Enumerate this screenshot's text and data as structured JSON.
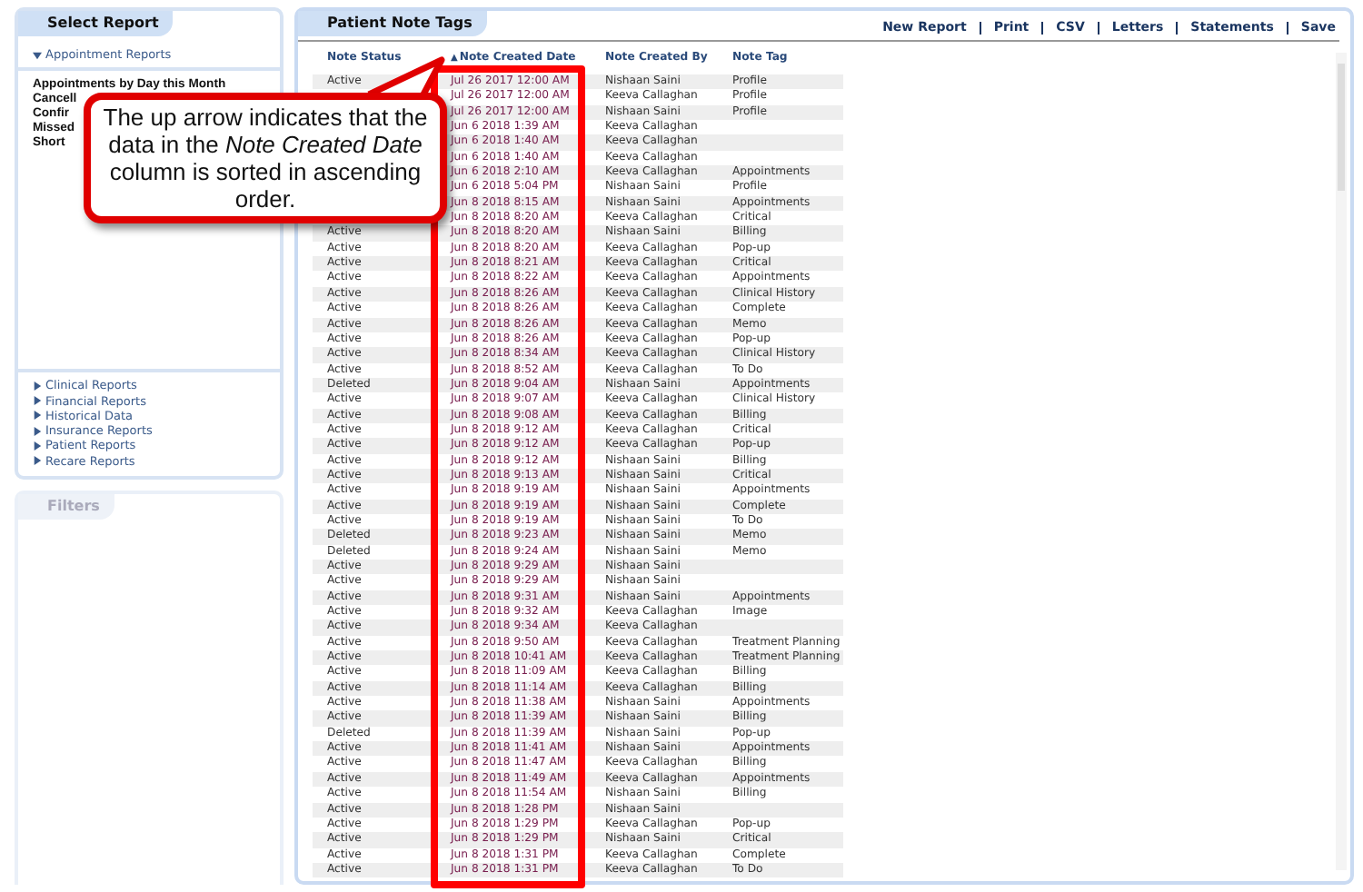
{
  "sidebar": {
    "title": "Select Report",
    "group": {
      "label": "Appointment Reports",
      "expanded": true
    },
    "items": [
      "Appointments by Day this Month",
      "Cancell",
      "Confir",
      "Missed",
      "Short"
    ],
    "categories": [
      {
        "label": "Clinical Reports",
        "expanded": false
      },
      {
        "label": "Financial Reports",
        "expanded": false
      },
      {
        "label": "Historical Data",
        "expanded": false
      },
      {
        "label": "Insurance Reports",
        "expanded": false
      },
      {
        "label": "Patient Reports",
        "expanded": false
      },
      {
        "label": "Recare Reports",
        "expanded": false
      }
    ],
    "filters_title": "Filters"
  },
  "report": {
    "title": "Patient Note Tags",
    "actions": [
      "New Report",
      "Print",
      "CSV",
      "Letters",
      "Statements",
      "Save"
    ],
    "columns": [
      {
        "label": "Note Status"
      },
      {
        "label": "Note Created Date",
        "sort_arrow": "▲"
      },
      {
        "label": "Note Created By"
      },
      {
        "label": "Note Tag"
      }
    ],
    "rows": [
      {
        "status": "Active",
        "date": "Jul 26 2017 12:00 AM",
        "by": "Nishaan Saini",
        "tag": "Profile"
      },
      {
        "date": "Jul 26 2017 12:00 AM",
        "by": "Keeva Callaghan",
        "tag": "Profile"
      },
      {
        "date": "Jul 26 2017 12:00 AM",
        "by": "Nishaan Saini",
        "tag": "Profile"
      },
      {
        "date": "Jun 6 2018 1:39 AM",
        "by": "Keeva Callaghan"
      },
      {
        "date": "Jun 6 2018 1:40 AM",
        "by": "Keeva Callaghan"
      },
      {
        "date": "Jun 6 2018 1:40 AM",
        "by": "Keeva Callaghan"
      },
      {
        "date": "Jun 6 2018 2:10 AM",
        "by": "Keeva Callaghan",
        "tag": "Appointments"
      },
      {
        "date": "Jun 6 2018 5:04 PM",
        "by": "Nishaan Saini",
        "tag": "Profile"
      },
      {
        "date": "Jun 8 2018 8:15 AM",
        "by": "Nishaan Saini",
        "tag": "Appointments"
      },
      {
        "date": "Jun 8 2018 8:20 AM",
        "by": "Keeva Callaghan",
        "tag": "Critical"
      },
      {
        "status": "Active",
        "date": "Jun 8 2018 8:20 AM",
        "by": "Nishaan Saini",
        "tag": "Billing"
      },
      {
        "status": "Active",
        "date": "Jun 8 2018 8:20 AM",
        "by": "Keeva Callaghan",
        "tag": "Pop-up"
      },
      {
        "status": "Active",
        "date": "Jun 8 2018 8:21 AM",
        "by": "Keeva Callaghan",
        "tag": "Critical"
      },
      {
        "status": "Active",
        "date": "Jun 8 2018 8:22 AM",
        "by": "Keeva Callaghan",
        "tag": "Appointments"
      },
      {
        "status": "Active",
        "date": "Jun 8 2018 8:26 AM",
        "by": "Keeva Callaghan",
        "tag": "Clinical History"
      },
      {
        "status": "Active",
        "date": "Jun 8 2018 8:26 AM",
        "by": "Keeva Callaghan",
        "tag": "Complete"
      },
      {
        "status": "Active",
        "date": "Jun 8 2018 8:26 AM",
        "by": "Keeva Callaghan",
        "tag": "Memo"
      },
      {
        "status": "Active",
        "date": "Jun 8 2018 8:26 AM",
        "by": "Keeva Callaghan",
        "tag": "Pop-up"
      },
      {
        "status": "Active",
        "date": "Jun 8 2018 8:34 AM",
        "by": "Keeva Callaghan",
        "tag": "Clinical History"
      },
      {
        "status": "Active",
        "date": "Jun 8 2018 8:52 AM",
        "by": "Keeva Callaghan",
        "tag": "To Do"
      },
      {
        "status": "Deleted",
        "date": "Jun 8 2018 9:04 AM",
        "by": "Nishaan Saini",
        "tag": "Appointments"
      },
      {
        "status": "Active",
        "date": "Jun 8 2018 9:07 AM",
        "by": "Keeva Callaghan",
        "tag": "Clinical History"
      },
      {
        "status": "Active",
        "date": "Jun 8 2018 9:08 AM",
        "by": "Keeva Callaghan",
        "tag": "Billing"
      },
      {
        "status": "Active",
        "date": "Jun 8 2018 9:12 AM",
        "by": "Keeva Callaghan",
        "tag": "Critical"
      },
      {
        "status": "Active",
        "date": "Jun 8 2018 9:12 AM",
        "by": "Keeva Callaghan",
        "tag": "Pop-up"
      },
      {
        "status": "Active",
        "date": "Jun 8 2018 9:12 AM",
        "by": "Nishaan Saini",
        "tag": "Billing"
      },
      {
        "status": "Active",
        "date": "Jun 8 2018 9:13 AM",
        "by": "Nishaan Saini",
        "tag": "Critical"
      },
      {
        "status": "Active",
        "date": "Jun 8 2018 9:19 AM",
        "by": "Nishaan Saini",
        "tag": "Appointments"
      },
      {
        "status": "Active",
        "date": "Jun 8 2018 9:19 AM",
        "by": "Nishaan Saini",
        "tag": "Complete"
      },
      {
        "status": "Active",
        "date": "Jun 8 2018 9:19 AM",
        "by": "Nishaan Saini",
        "tag": "To Do"
      },
      {
        "status": "Deleted",
        "date": "Jun 8 2018 9:23 AM",
        "by": "Nishaan Saini",
        "tag": "Memo"
      },
      {
        "status": "Deleted",
        "date": "Jun 8 2018 9:24 AM",
        "by": "Nishaan Saini",
        "tag": "Memo"
      },
      {
        "status": "Active",
        "date": "Jun 8 2018 9:29 AM",
        "by": "Nishaan Saini"
      },
      {
        "status": "Active",
        "date": "Jun 8 2018 9:29 AM",
        "by": "Nishaan Saini"
      },
      {
        "status": "Active",
        "date": "Jun 8 2018 9:31 AM",
        "by": "Nishaan Saini",
        "tag": "Appointments"
      },
      {
        "status": "Active",
        "date": "Jun 8 2018 9:32 AM",
        "by": "Keeva Callaghan",
        "tag": "Image"
      },
      {
        "status": "Active",
        "date": "Jun 8 2018 9:34 AM",
        "by": "Keeva Callaghan"
      },
      {
        "status": "Active",
        "date": "Jun 8 2018 9:50 AM",
        "by": "Keeva Callaghan",
        "tag": "Treatment Planning"
      },
      {
        "status": "Active",
        "date": "Jun 8 2018 10:41 AM",
        "by": "Keeva Callaghan",
        "tag": "Treatment Planning"
      },
      {
        "status": "Active",
        "date": "Jun 8 2018 11:09 AM",
        "by": "Keeva Callaghan",
        "tag": "Billing"
      },
      {
        "status": "Active",
        "date": "Jun 8 2018 11:14 AM",
        "by": "Keeva Callaghan",
        "tag": "Billing"
      },
      {
        "status": "Active",
        "date": "Jun 8 2018 11:38 AM",
        "by": "Nishaan Saini",
        "tag": "Appointments"
      },
      {
        "status": "Active",
        "date": "Jun 8 2018 11:39 AM",
        "by": "Nishaan Saini",
        "tag": "Billing"
      },
      {
        "status": "Deleted",
        "date": "Jun 8 2018 11:39 AM",
        "by": "Nishaan Saini",
        "tag": "Pop-up"
      },
      {
        "status": "Active",
        "date": "Jun 8 2018 11:41 AM",
        "by": "Nishaan Saini",
        "tag": "Appointments"
      },
      {
        "status": "Active",
        "date": "Jun 8 2018 11:47 AM",
        "by": "Keeva Callaghan",
        "tag": "Billing"
      },
      {
        "status": "Active",
        "date": "Jun 8 2018 11:49 AM",
        "by": "Keeva Callaghan",
        "tag": "Appointments"
      },
      {
        "status": "Active",
        "date": "Jun 8 2018 11:54 AM",
        "by": "Nishaan Saini",
        "tag": "Billing"
      },
      {
        "status": "Active",
        "date": "Jun 8 2018 1:28 PM",
        "by": "Nishaan Saini"
      },
      {
        "status": "Active",
        "date": "Jun 8 2018 1:29 PM",
        "by": "Keeva Callaghan",
        "tag": "Pop-up"
      },
      {
        "status": "Active",
        "date": "Jun 8 2018 1:29 PM",
        "by": "Nishaan Saini",
        "tag": "Critical"
      },
      {
        "status": "Active",
        "date": "Jun 8 2018 1:31 PM",
        "by": "Keeva Callaghan",
        "tag": "Complete"
      },
      {
        "status": "Active",
        "date": "Jun 8 2018 1:31 PM",
        "by": "Keeva Callaghan",
        "tag": "To Do"
      }
    ]
  },
  "annotation": {
    "callout": "The up arrow indicates that the data in the *Note Created Date* column is sorted in ascending order."
  }
}
